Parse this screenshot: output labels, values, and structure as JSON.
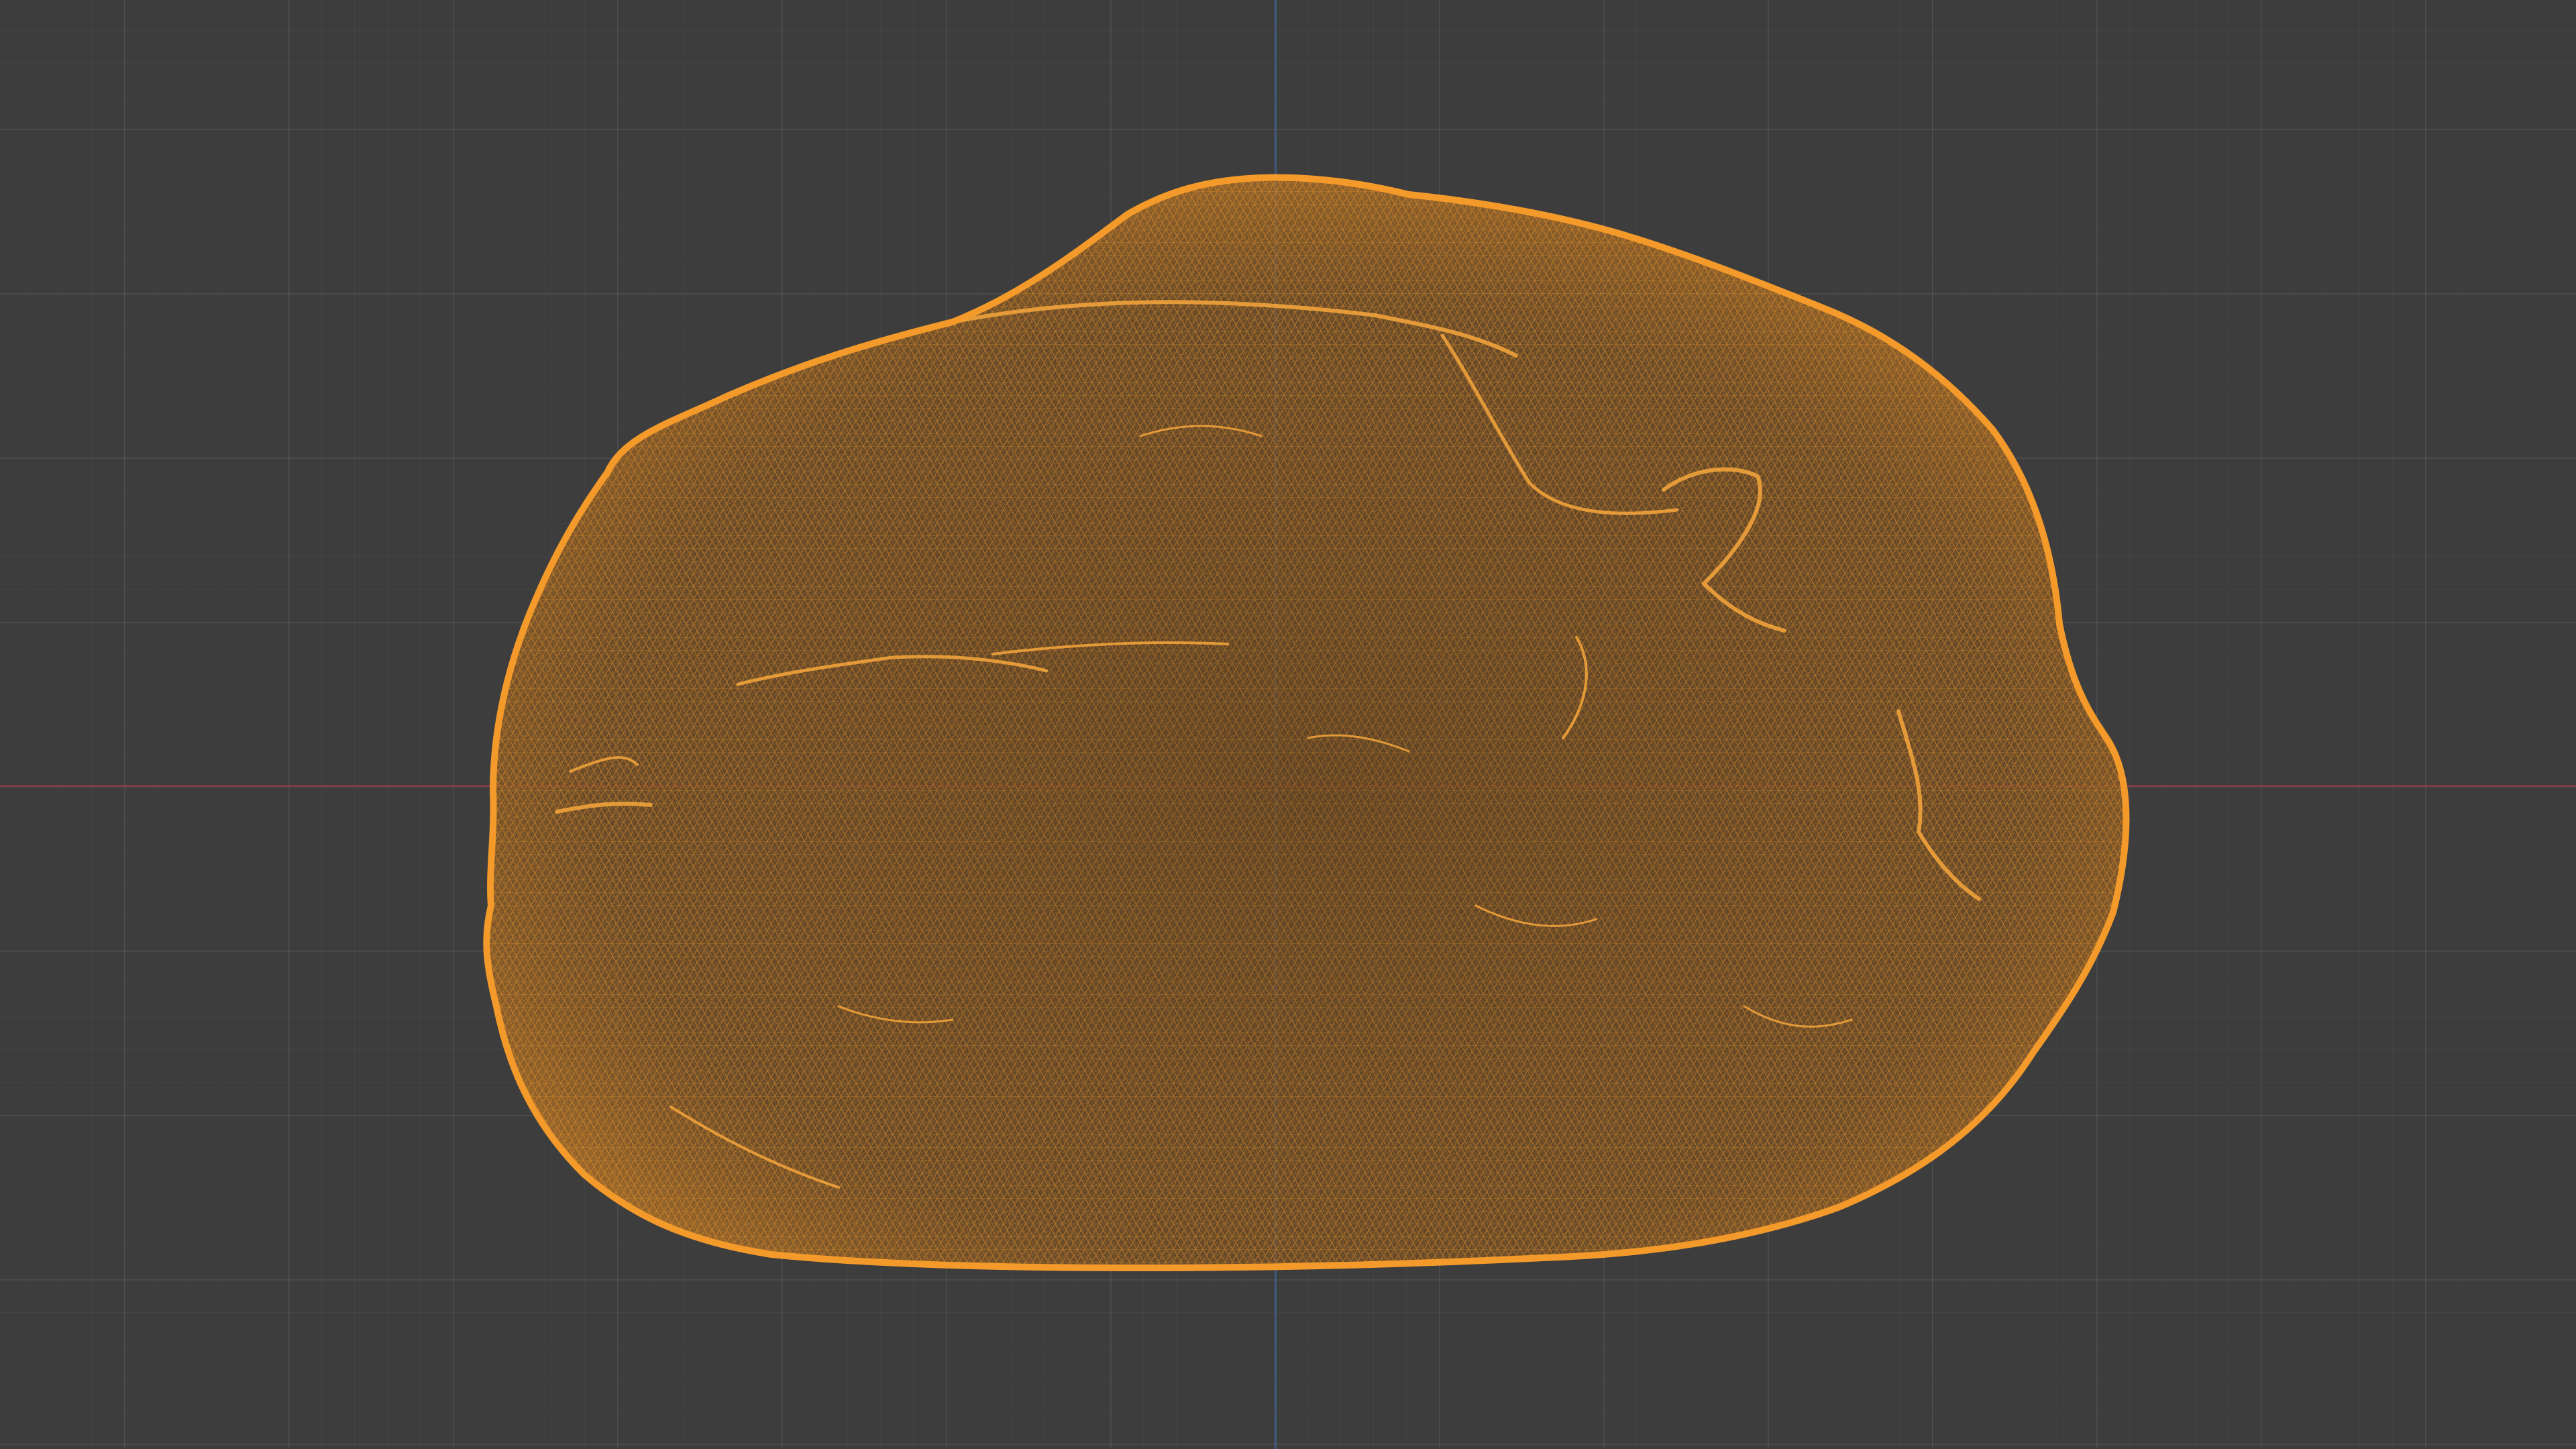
{
  "viewport": {
    "background_color": "#3d3d3d",
    "grid_color": "#4a4a4a",
    "x_axis_color": "#8a3b44",
    "y_axis_color": "#3e5f8c"
  },
  "mesh": {
    "object": "rock-mesh",
    "display_mode": "wireframe",
    "state": "selected",
    "wire_color": "#f39a2b",
    "fill_color": "#7a4f1f"
  }
}
